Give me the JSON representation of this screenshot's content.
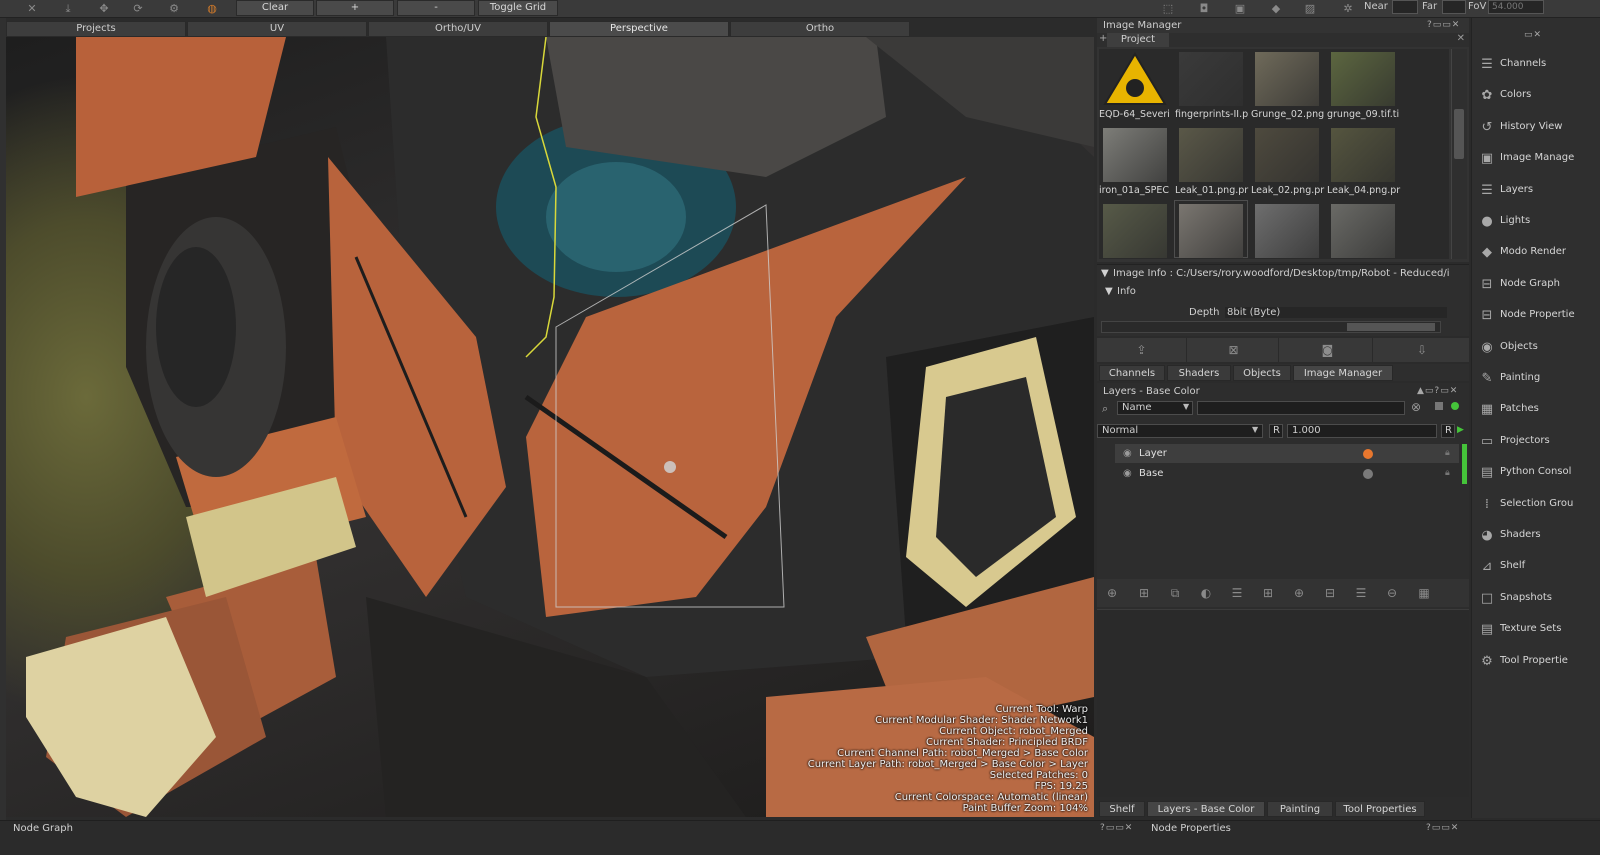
{
  "toolbar": {
    "clear_label": "Clear",
    "plus_label": "+",
    "minus_label": "-",
    "toggle_grid_label": "Toggle Grid",
    "near_label": "Near",
    "far_label": "Far",
    "fov_label": "FoV",
    "fov_value": "54.000"
  },
  "viewport_tabs": [
    "Projects",
    "UV",
    "Ortho/UV",
    "Perspective",
    "Ortho"
  ],
  "viewport_hud": [
    "Current Tool: Warp",
    "Current Modular Shader: Shader Network1",
    "Current Object: robot_Merged",
    "Current Shader: Principled BRDF",
    "Current Channel Path: robot_Merged > Base Color",
    "Current Layer Path: robot_Merged > Base Color > Layer",
    "Selected Patches: 0",
    "FPS: 19.25",
    "Current Colorspace: Automatic (linear)",
    "Paint Buffer Zoom: 104%"
  ],
  "image_manager": {
    "title": "Image Manager",
    "tab": "Project",
    "thumbnails": [
      {
        "caption": "EQD-64_Severi",
        "color": "#e8b400"
      },
      {
        "caption": "fingerprints-II.p",
        "color": "#3a3a3a"
      },
      {
        "caption": "Grunge_02.png",
        "color": "#6f6a5a"
      },
      {
        "caption": "grunge_09.tif.ti",
        "color": "#5c6640"
      },
      {
        "caption": "iron_01a_SPEC",
        "color": "#7d7d78"
      },
      {
        "caption": "Leak_01.png.pr",
        "color": "#5a5848"
      },
      {
        "caption": "Leak_02.png.pr",
        "color": "#4e4a3e"
      },
      {
        "caption": "Leak_04.png.pr",
        "color": "#55553f"
      },
      {
        "caption": "",
        "color": "#575a48"
      },
      {
        "caption": "",
        "color": "#7a7670"
      },
      {
        "caption": "",
        "color": "#6e6e6e"
      },
      {
        "caption": "",
        "color": "#6a6a66"
      }
    ]
  },
  "image_info": {
    "path": "Image Info : C:/Users/rory.woodford/Desktop/tmp/Robot - Reduced/i",
    "section": "Info",
    "depth_label": "Depth",
    "depth_value": "8bit  (Byte)"
  },
  "panel_tabs": [
    "Channels",
    "Shaders",
    "Objects",
    "Image Manager"
  ],
  "layers_panel": {
    "title": "Layers - Base Color",
    "filter_field": "Name",
    "blend_mode": "Normal",
    "opacity_flag": "R",
    "opacity_value": "1.000",
    "layers": [
      {
        "name": "Layer",
        "selected": true,
        "dot_color": "#e8772e"
      },
      {
        "name": "Base",
        "selected": false,
        "dot_color": "#7a7a7a"
      }
    ]
  },
  "bottom_tabs": [
    "Shelf",
    "Layers - Base Color",
    "Painting",
    "Tool Properties"
  ],
  "shelf": [
    {
      "label": "Channels",
      "icon": "channels-icon",
      "glyph": "☰"
    },
    {
      "label": "Colors",
      "icon": "colors-icon",
      "glyph": "✿"
    },
    {
      "label": "History View",
      "icon": "history-icon",
      "glyph": "↺"
    },
    {
      "label": "Image Manage",
      "icon": "image-manager-icon",
      "glyph": "▣"
    },
    {
      "label": "Layers",
      "icon": "layers-icon",
      "glyph": "☰"
    },
    {
      "label": "Lights",
      "icon": "lights-icon",
      "glyph": "●"
    },
    {
      "label": "Modo Render",
      "icon": "modo-render-icon",
      "glyph": "◆"
    },
    {
      "label": "Node Graph",
      "icon": "node-graph-icon",
      "glyph": "⊟"
    },
    {
      "label": "Node Propertie",
      "icon": "node-properties-icon",
      "glyph": "⊟"
    },
    {
      "label": "Objects",
      "icon": "objects-icon",
      "glyph": "◉"
    },
    {
      "label": "Painting",
      "icon": "painting-icon",
      "glyph": "✎"
    },
    {
      "label": "Patches",
      "icon": "patches-icon",
      "glyph": "▦"
    },
    {
      "label": "Projectors",
      "icon": "projectors-icon",
      "glyph": "▭"
    },
    {
      "label": "Python Consol",
      "icon": "python-console-icon",
      "glyph": "▤"
    },
    {
      "label": "Selection Grou",
      "icon": "selection-groups-icon",
      "glyph": "⁞"
    },
    {
      "label": "Shaders",
      "icon": "shaders-icon",
      "glyph": "◕"
    },
    {
      "label": "Shelf",
      "icon": "shelf-icon",
      "glyph": "⊿"
    },
    {
      "label": "Snapshots",
      "icon": "snapshots-icon",
      "glyph": "□"
    },
    {
      "label": "Texture Sets",
      "icon": "texture-sets-icon",
      "glyph": "▤"
    },
    {
      "label": "Tool Propertie",
      "icon": "tool-properties-icon",
      "glyph": "⚙"
    }
  ],
  "status": {
    "node_graph": "Node Graph",
    "node_properties": "Node Properties"
  },
  "colors": {
    "accent_green": "#45c43a",
    "rust_orange": "#b8613a",
    "bg_panel": "#2d2d2d"
  }
}
